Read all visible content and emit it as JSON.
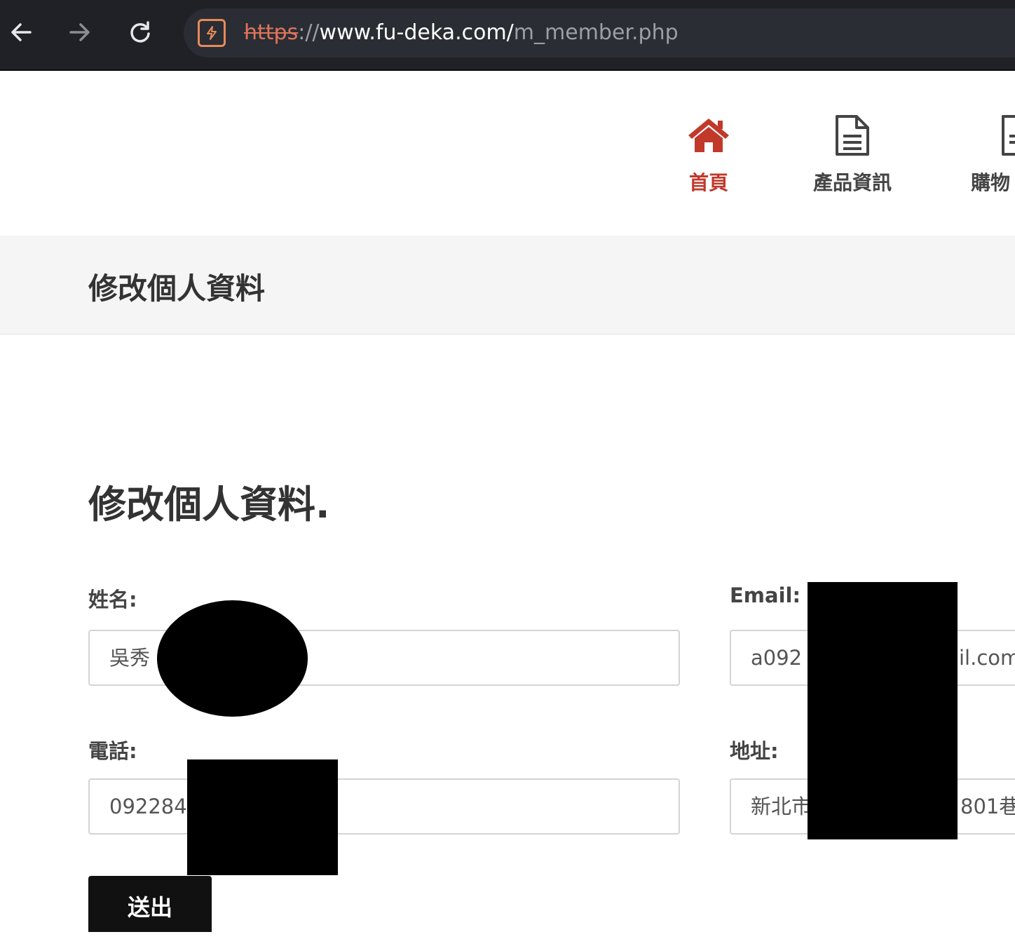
{
  "browser": {
    "url_scheme": "https",
    "url_sep": "://",
    "url_host": "www.fu-deka.com/",
    "url_path": "m_member.php"
  },
  "nav": {
    "items": [
      {
        "label": "首頁",
        "icon": "home-icon",
        "active": true
      },
      {
        "label": "產品資訊",
        "icon": "document-icon",
        "active": false
      },
      {
        "label": "購物",
        "icon": "cart-document-icon",
        "active": false
      }
    ]
  },
  "page": {
    "band_title": "修改個人資料",
    "form_title": "修改個人資料."
  },
  "form": {
    "name_label": "姓名:",
    "name_value": "吳秀",
    "email_label": "Email:",
    "email_value": "a092",
    "email_value_tail": "il.com",
    "phone_label": "電話:",
    "phone_value": "092284",
    "address_label": "地址:",
    "address_value": "新北市",
    "address_value_tail": "801巷",
    "submit_label": "送出"
  },
  "colors": {
    "accent": "#c0392b",
    "browser_bg": "#1f2126"
  }
}
